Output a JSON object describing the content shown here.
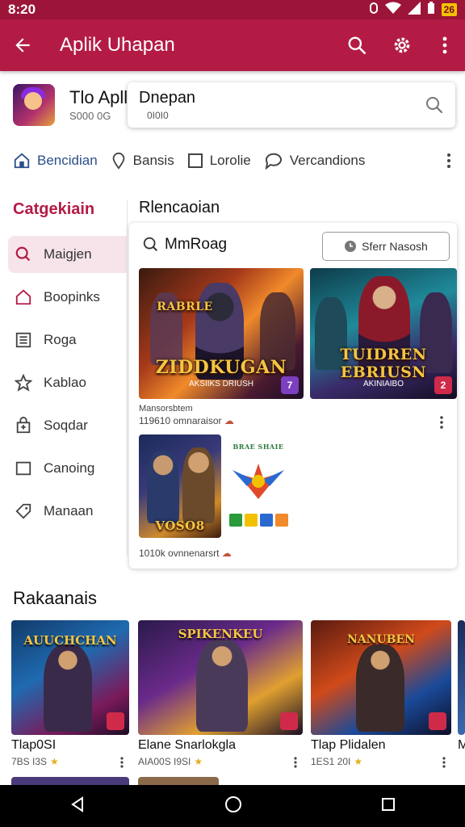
{
  "status_bar": {
    "time": "8:20",
    "battery_badge": "26"
  },
  "app_bar": {
    "title": "Aplik Uhapan",
    "back_icon": "arrow-left-icon",
    "search_icon": "search-icon",
    "settings_icon": "gear-icon",
    "more_icon": "more-vert-icon",
    "bar_color": "#b31b45"
  },
  "header": {
    "app_name": "Tlo Apll",
    "app_sub": "S000 0G"
  },
  "search_card": {
    "title": "Dnepan",
    "sub": "0I0I0"
  },
  "tabs": [
    {
      "label": "Bencidian",
      "icon": "home-icon"
    },
    {
      "label": "Bansis",
      "icon": "location-pin-icon"
    },
    {
      "label": "Lorolie",
      "icon": "square-icon"
    },
    {
      "label": "Vercandions",
      "icon": "chat-bubble-icon"
    }
  ],
  "sidebar": {
    "title": "Catgekiain",
    "items": [
      {
        "label": "Maigjen",
        "icon": "search-icon"
      },
      {
        "label": "Boopinks",
        "icon": "house-icon"
      },
      {
        "label": "Roga",
        "icon": "list-icon"
      },
      {
        "label": "Kablao",
        "icon": "star-icon"
      },
      {
        "label": "Soqdar",
        "icon": "bag-icon"
      },
      {
        "label": "Canoing",
        "icon": "square-icon"
      },
      {
        "label": "Manaan",
        "icon": "tag-icon"
      }
    ]
  },
  "main": {
    "title": "Rlencaoian",
    "search_label": "MmRoag",
    "filter_button": "Sferr Nasosh",
    "thumbs": [
      {
        "title": "ZIDDKUGAN",
        "top_title": "RABRLE",
        "sub": "AKSIIKS DRIUSH",
        "badge": "7"
      },
      {
        "title": "TUIDREN EBRIUSN",
        "top_title": "",
        "sub": "AKINIAIBO",
        "badge": "2"
      },
      {
        "title": "VOSO8",
        "top_title": "",
        "sub": "",
        "badge": ""
      },
      {
        "title": "",
        "top_title": "BRAE SHAIE",
        "sub": "",
        "badge": ""
      }
    ],
    "caption_1_title": "Mansorsbtem",
    "caption_1": "119610 omnaraisor",
    "caption_2": "1010k ovnnenarsrt"
  },
  "recommended": {
    "title": "Rakaanais",
    "items": [
      {
        "name": "Tlap0SI",
        "meta": "7BS I3S",
        "img_title": "AUUCHCHAN"
      },
      {
        "name": "Elane Snarlokgla",
        "meta": "AIA00S I9SI",
        "img_title": "SPIKENKEU"
      },
      {
        "name": "Tlap Plidalen",
        "meta": "1ES1 20I",
        "img_title": "NANUBEN"
      },
      {
        "name": "M",
        "meta": "",
        "img_title": ""
      }
    ]
  }
}
